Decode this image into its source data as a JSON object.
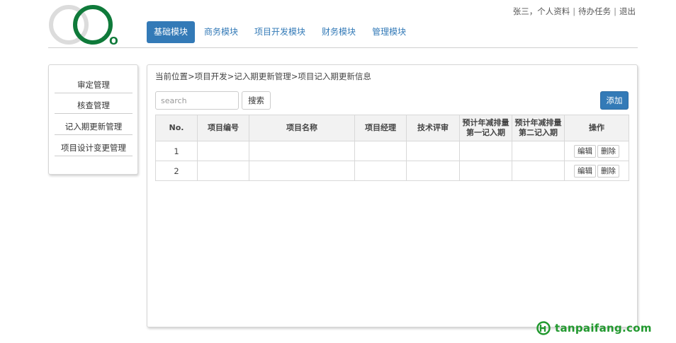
{
  "logo": {
    "text": "O2"
  },
  "user_bar": {
    "user_name": "张三",
    "profile_link": "个人资料",
    "tasks_link": "待办任务",
    "logout_link": "退出"
  },
  "nav": {
    "items": [
      {
        "label": "基础模块",
        "active": true
      },
      {
        "label": "商务模块",
        "active": false
      },
      {
        "label": "项目开发模块",
        "active": false
      },
      {
        "label": "财务模块",
        "active": false
      },
      {
        "label": "管理模块",
        "active": false
      }
    ]
  },
  "sidebar": {
    "items": [
      {
        "label": "审定管理"
      },
      {
        "label": "核查管理"
      },
      {
        "label": "记入期更新管理"
      },
      {
        "label": "项目设计变更管理"
      }
    ]
  },
  "main": {
    "breadcrumb": "当前位置>项目开发>记入期更新管理>项目记入期更新信息",
    "search": {
      "placeholder": "search",
      "value": ""
    },
    "search_button": "搜索",
    "add_button": "添加",
    "table": {
      "headers": [
        "No.",
        "项目编号",
        "项目名称",
        "项目经理",
        "技术评审",
        "预计年减排量第一记入期",
        "预计年减排量第二记入期",
        "操作"
      ],
      "rows": [
        {
          "no": "1",
          "code": "",
          "name": "",
          "manager": "",
          "review": "",
          "reduction1": "",
          "reduction2": ""
        },
        {
          "no": "2",
          "code": "",
          "name": "",
          "manager": "",
          "review": "",
          "reduction1": "",
          "reduction2": ""
        }
      ],
      "edit_label": "编辑",
      "delete_label": "删除"
    }
  },
  "watermark": {
    "text": "tanpaifang.com"
  },
  "colors": {
    "primary": "#337ab7",
    "logo_green": "#0f7a3a",
    "logo_gray": "#dcdcdc",
    "watermark_green": "#22992f"
  }
}
